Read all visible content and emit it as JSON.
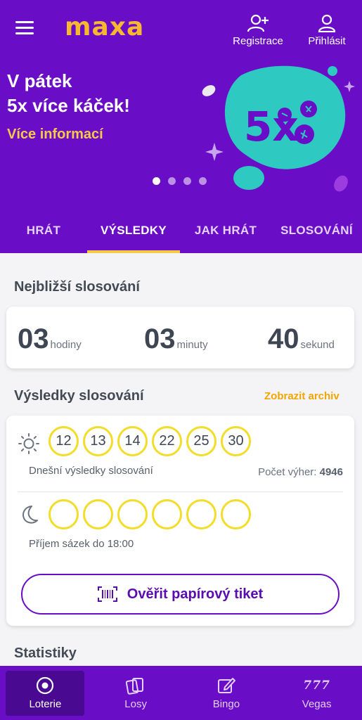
{
  "header": {
    "logo": "maxa",
    "register_label": "Registrace",
    "login_label": "Přihlásit"
  },
  "promo": {
    "title_line1": "V pátek",
    "title_line2": "5x více káček!",
    "link": "Více informací",
    "badge_text": "5x",
    "slides": 4,
    "active_slide": 1
  },
  "tabs": [
    {
      "label": "HRÁT"
    },
    {
      "label": "VÝSLEDKY"
    },
    {
      "label": "JAK HRÁT"
    },
    {
      "label": "SLOSOVÁNÍ"
    }
  ],
  "countdown": {
    "title": "Nejbližší slosování",
    "hours": "03",
    "hours_label": "hodiny",
    "minutes": "03",
    "minutes_label": "minuty",
    "seconds": "40",
    "seconds_label": "sekund"
  },
  "results": {
    "title": "Výsledky slosování",
    "archive_link": "Zobrazit archiv",
    "day_numbers": [
      "12",
      "13",
      "14",
      "22",
      "25",
      "30"
    ],
    "day_label": "Dnešní výsledky slosování",
    "wins_label": "Počet výher:",
    "wins_count": "4946",
    "night_label": "Příjem sázek do 18:00",
    "verify_button": "Ověřit papírový tiket"
  },
  "stats": {
    "title": "Statistiky"
  },
  "bottom_nav": [
    {
      "label": "Loterie",
      "icon": "lottery-ball-icon",
      "active": true
    },
    {
      "label": "Losy",
      "icon": "tickets-icon"
    },
    {
      "label": "Bingo",
      "icon": "edit-card-icon"
    },
    {
      "label": "Vegas",
      "icon": "777",
      "glyph": "777"
    }
  ],
  "colors": {
    "brand_purple": "#6a0dc6",
    "accent_yellow": "#f7c948",
    "logo_orange": "#f7b731",
    "ball_border": "#f2dd2a",
    "archive_orange": "#f0a500",
    "promo_teal": "#2ec9c1"
  }
}
